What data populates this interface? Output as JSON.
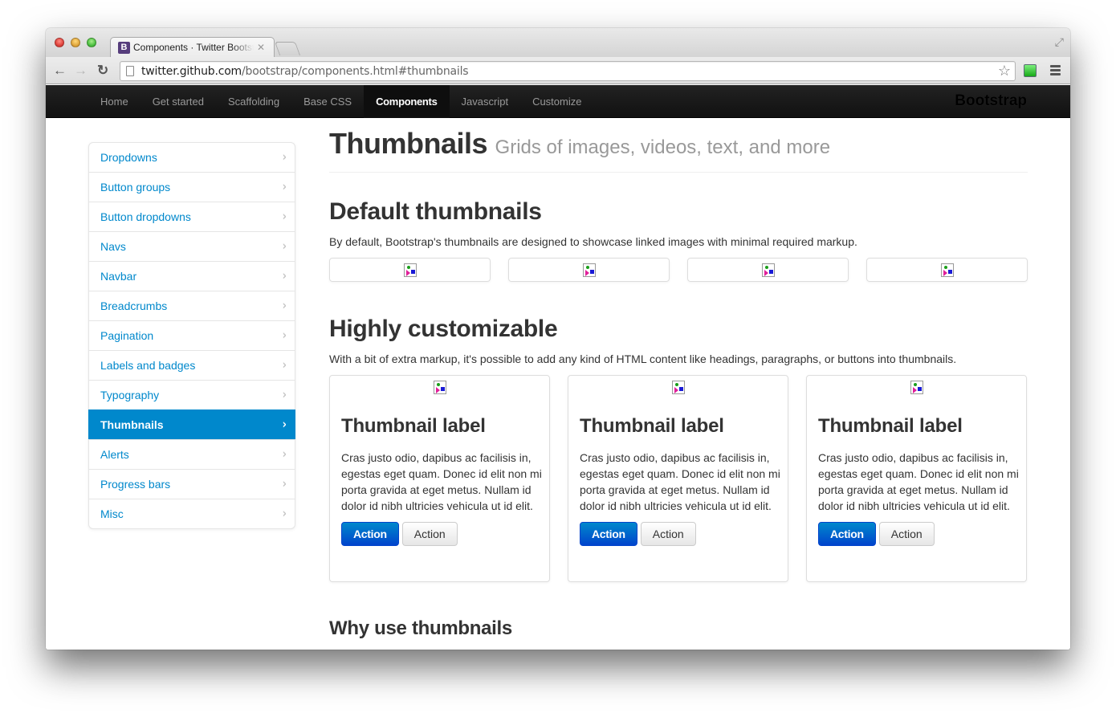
{
  "browser": {
    "tab_title": "Components · Twitter Bootstrap",
    "favicon_letter": "B",
    "url_host": "twitter.github.com",
    "url_path": "/bootstrap/components.html#thumbnails",
    "icons": {
      "back": "←",
      "forward": "→",
      "reload": "↻",
      "star": "☆",
      "close": "✕",
      "fullscreen": "⤢"
    }
  },
  "navbar": {
    "items": [
      {
        "label": "Home",
        "active": false
      },
      {
        "label": "Get started",
        "active": false
      },
      {
        "label": "Scaffolding",
        "active": false
      },
      {
        "label": "Base CSS",
        "active": false
      },
      {
        "label": "Components",
        "active": true
      },
      {
        "label": "Javascript",
        "active": false
      },
      {
        "label": "Customize",
        "active": false
      }
    ],
    "brand": "Bootstrap"
  },
  "sidebar": {
    "chevron": "›",
    "items": [
      {
        "label": "Dropdowns",
        "active": false
      },
      {
        "label": "Button groups",
        "active": false
      },
      {
        "label": "Button dropdowns",
        "active": false
      },
      {
        "label": "Navs",
        "active": false
      },
      {
        "label": "Navbar",
        "active": false
      },
      {
        "label": "Breadcrumbs",
        "active": false
      },
      {
        "label": "Pagination",
        "active": false
      },
      {
        "label": "Labels and badges",
        "active": false
      },
      {
        "label": "Typography",
        "active": false
      },
      {
        "label": "Thumbnails",
        "active": true
      },
      {
        "label": "Alerts",
        "active": false
      },
      {
        "label": "Progress bars",
        "active": false
      },
      {
        "label": "Misc",
        "active": false
      }
    ]
  },
  "main": {
    "title": "Thumbnails",
    "subtitle": "Grids of images, videos, text, and more",
    "default_section": {
      "heading": "Default thumbnails",
      "description": "By default, Bootstrap's thumbnails are designed to showcase linked images with minimal required markup.",
      "thumbnail_count": 4
    },
    "custom_section": {
      "heading": "Highly customizable",
      "description": "With a bit of extra markup, it's possible to add any kind of HTML content like headings, paragraphs, or buttons into thumbnails.",
      "cards": [
        {
          "label": "Thumbnail label",
          "text": "Cras justo odio, dapibus ac facilisis in, egestas eget quam. Donec id elit non mi porta gravida at eget metus. Nullam id dolor id nibh ultricies vehicula ut id elit.",
          "primary_button": "Action",
          "secondary_button": "Action"
        },
        {
          "label": "Thumbnail label",
          "text": "Cras justo odio, dapibus ac facilisis in, egestas eget quam. Donec id elit non mi porta gravida at eget metus. Nullam id dolor id nibh ultricies vehicula ut id elit.",
          "primary_button": "Action",
          "secondary_button": "Action"
        },
        {
          "label": "Thumbnail label",
          "text": "Cras justo odio, dapibus ac facilisis in, egestas eget quam. Donec id elit non mi porta gravida at eget metus. Nullam id dolor id nibh ultricies vehicula ut id elit.",
          "primary_button": "Action",
          "secondary_button": "Action"
        }
      ]
    },
    "next_section_heading": "Why use thumbnails"
  },
  "colors": {
    "link": "#0088cc",
    "active_nav_bg": "#0088cc",
    "navbar_bg": "#1b1b1b",
    "primary_button": "#0044cc"
  }
}
